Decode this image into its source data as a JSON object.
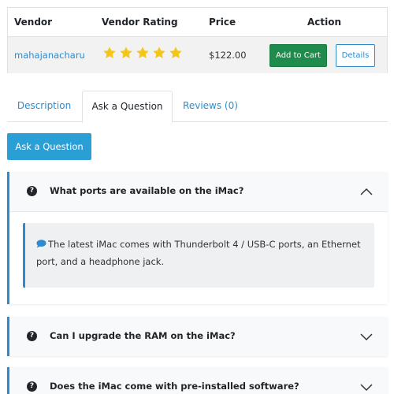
{
  "vendor_table": {
    "headers": {
      "vendor": "Vendor",
      "rating": "Vendor Rating",
      "price": "Price",
      "action": "Action"
    },
    "row": {
      "vendor_name": "mahajanacharu",
      "rating_stars": 5,
      "rating_max": 5,
      "price": "$122.00",
      "add_to_cart_label": "Add to Cart",
      "details_label": "Details"
    }
  },
  "tabs": [
    {
      "label": "Description",
      "active": false
    },
    {
      "label": "Ask a Question",
      "active": true
    },
    {
      "label": "Reviews (0)",
      "active": false
    }
  ],
  "ask_button_label": "Ask a Question",
  "faqs": [
    {
      "question": "What ports are available on the iMac?",
      "expanded": true,
      "answer": "The latest iMac comes with Thunderbolt 4 / USB-C ports, an Ethernet port, and a headphone jack."
    },
    {
      "question": "Can I upgrade the RAM on the iMac?",
      "expanded": false
    },
    {
      "question": "Does the iMac come with pre-installed software?",
      "expanded": false
    }
  ],
  "colors": {
    "link": "#2a8ccf",
    "add_to_cart": "#1f8b4c",
    "ask_button": "#2a9fd6",
    "star": "#f5c518",
    "accent_border": "#2a8ccf"
  },
  "icons": {
    "question": "question-circle-icon",
    "answer": "speech-bubble-icon",
    "expanded": "chevron-up-icon",
    "collapsed": "chevron-down-icon",
    "rating": "star-icon"
  }
}
